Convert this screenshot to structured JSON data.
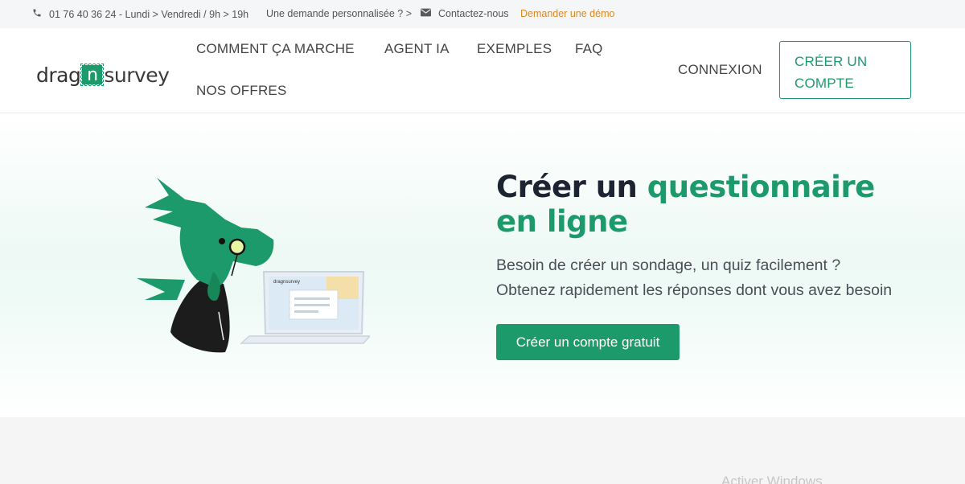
{
  "topbar": {
    "phone_icon": "phone-icon",
    "phone_text": "01 76 40 36 24 - Lundi > Vendredi / 9h > 19h",
    "custom_request": "Une demande personnalisée ? >",
    "mail_icon": "envelope-icon",
    "contact": "Contactez-nous",
    "demo": "Demander une démo",
    "demo_color": "#d9892a"
  },
  "logo": {
    "part1": "drag",
    "n": "n",
    "part2": "survey"
  },
  "nav": {
    "items": [
      "COMMENT ÇA MARCHE",
      "AGENT IA",
      "EXEMPLES",
      "FAQ",
      "NOS OFFRES"
    ],
    "login": "CONNEXION",
    "signup_line1": "CRÉER UN",
    "signup_line2": "COMPTE"
  },
  "hero": {
    "title_dark": "Créer un ",
    "title_green": "questionnaire en ligne",
    "subtitle_line1": "Besoin de créer un sondage, un quiz facilement ?",
    "subtitle_line2": "Obtenez rapidement les réponses dont vous avez besoin",
    "cta": "Créer un compte gratuit",
    "laptop_logo": "dragnsurvey"
  },
  "colors": {
    "brand_green": "#1d9a6c",
    "dark_text": "#1c2433"
  },
  "watermark": "Activer Windows"
}
